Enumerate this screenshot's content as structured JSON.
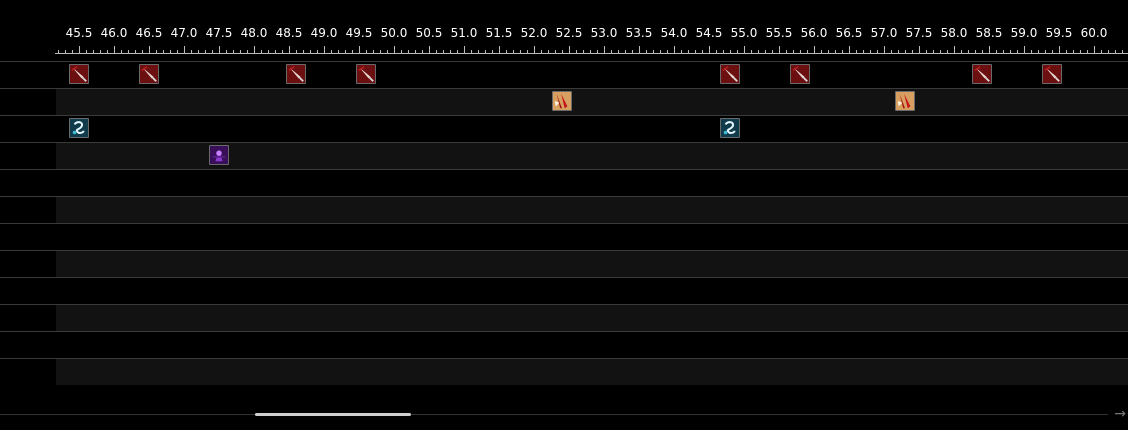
{
  "timeline": {
    "ticks": [
      "45.5",
      "46.0",
      "46.5",
      "47.0",
      "47.5",
      "48.0",
      "48.5",
      "49.0",
      "49.5",
      "50.0",
      "50.5",
      "51.0",
      "51.5",
      "52.0",
      "52.5",
      "53.0",
      "53.5",
      "54.0",
      "54.5",
      "55.0",
      "55.5",
      "56.0",
      "56.5",
      "57.0",
      "57.5",
      "58.0",
      "58.5",
      "59.0",
      "59.5",
      "60.0",
      "60"
    ],
    "start": 45.5,
    "step": 0.5,
    "rows": [
      {
        "icon": "red-slash-ability-icon",
        "times": [
          45.5,
          46.5,
          48.6,
          49.6,
          54.8,
          55.8,
          58.4,
          59.4
        ]
      },
      {
        "icon": "fire-claw-ability-icon",
        "times": [
          52.4,
          57.3
        ]
      },
      {
        "icon": "water-swirl-ability-icon",
        "times": [
          45.5,
          54.8
        ]
      },
      {
        "icon": "purple-shadow-ability-icon",
        "times": [
          47.5
        ]
      },
      {
        "icon": "",
        "times": []
      },
      {
        "icon": "",
        "times": []
      },
      {
        "icon": "",
        "times": []
      },
      {
        "icon": "",
        "times": []
      },
      {
        "icon": "",
        "times": []
      },
      {
        "icon": "",
        "times": []
      },
      {
        "icon": "",
        "times": []
      },
      {
        "icon": "",
        "times": []
      }
    ]
  },
  "scrollbar": {
    "arrow": "→"
  },
  "colors": {
    "background": "#000000",
    "row_alt": "#121212",
    "tick": "#bbbbbb"
  }
}
